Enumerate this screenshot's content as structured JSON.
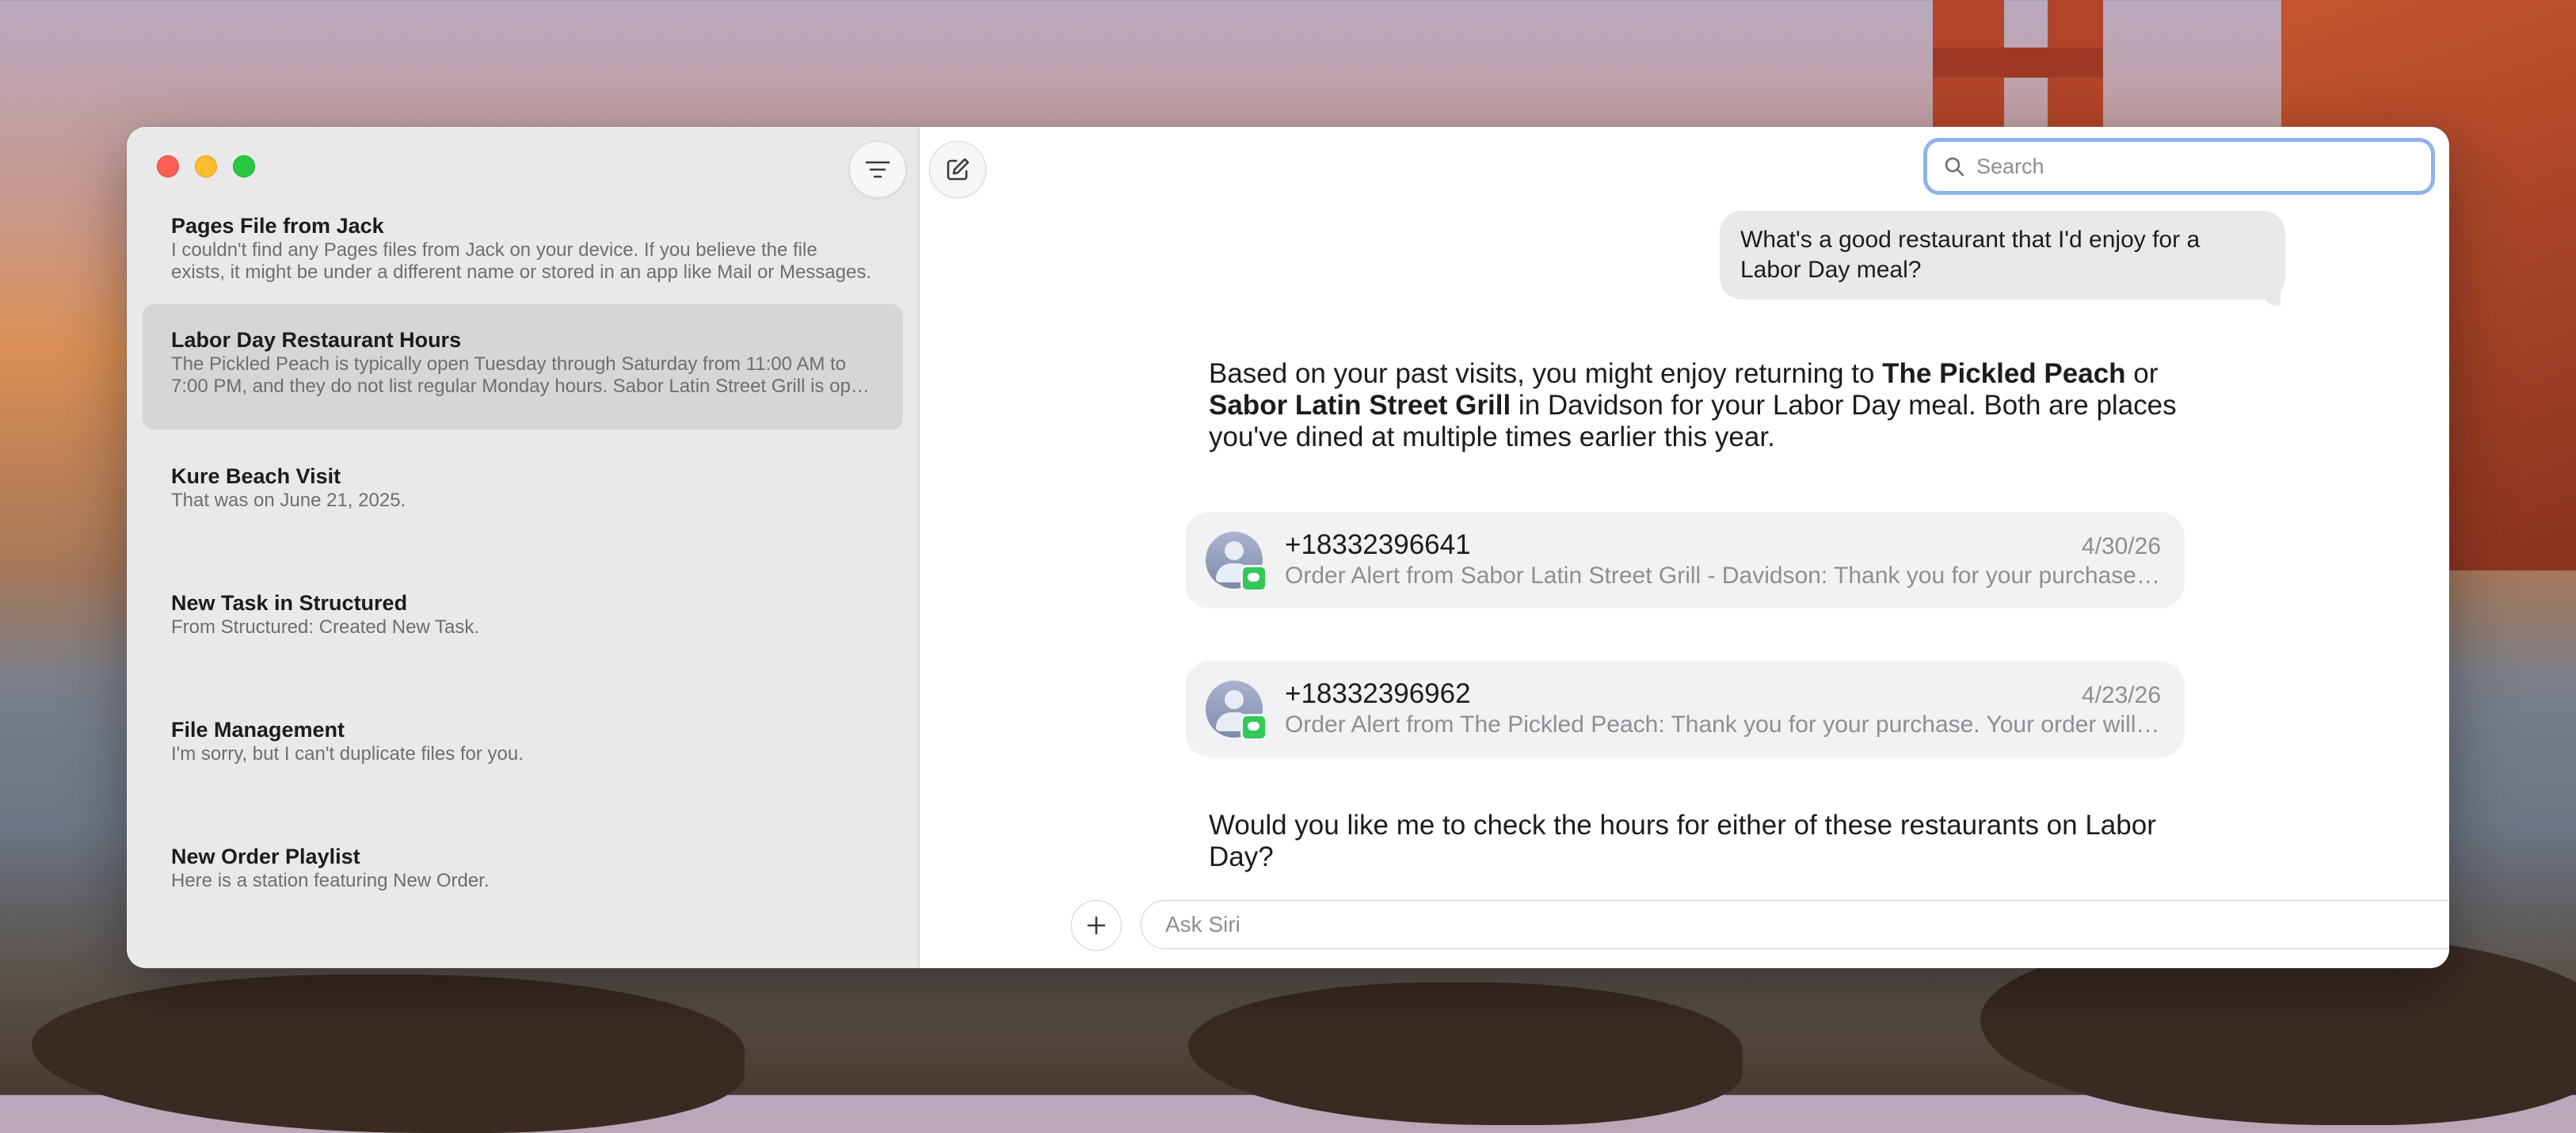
{
  "sidebar": {
    "conversations": [
      {
        "title": "Pages File from Jack",
        "preview": "I couldn't find any Pages files from Jack on your device. If you believe the file exists, it might be under a different name or stored in an app like Mail or Messages."
      },
      {
        "title": "Labor Day Restaurant Hours",
        "preview": "The Pickled Peach is typically open Tuesday through Saturday from 11:00 AM to 7:00 PM, and they do not list regular Monday hours. Sabor Latin Street Grill is open on Labor Day."
      },
      {
        "title": "Kure Beach Visit",
        "preview": "That was on June 21, 2025."
      },
      {
        "title": "New Task in Structured",
        "preview": "From Structured: Created New Task."
      },
      {
        "title": "File Management",
        "preview": "I'm sorry, but I can't duplicate files for you."
      },
      {
        "title": "New Order Playlist",
        "preview": "Here is a station featuring New Order."
      }
    ]
  },
  "search": {
    "placeholder": "Search"
  },
  "chat": {
    "user_message": "What's a good restaurant that I'd enjoy for a Labor Day meal?",
    "reply_1": {
      "t1": "Based on your past visits, you might enjoy returning to ",
      "b1": "The Pickled Peach",
      "t2": " or ",
      "b2": "Sabor Latin Street Grill",
      "t3": " in Davidson for your Labor Day meal. Both are places you've dined at multiple times earlier this year."
    },
    "messages": [
      {
        "sender": "+18332396641",
        "date": "4/30/26",
        "preview": "Order Alert from Sabor Latin Street Grill - Davidson: Thank you for your purchase. Your order will be ready soon."
      },
      {
        "sender": "+18332396962",
        "date": "4/23/26",
        "preview": "Order Alert from The Pickled Peach: Thank you for your purchase. Your order will be ready soon."
      }
    ],
    "reply_2": "Would you like me to check the hours for either of these restaurants on Labor Day?"
  },
  "composer": {
    "placeholder": "Ask Siri"
  },
  "colors": {
    "accent": "#8fb4ea",
    "selected_row": "#d6d6d8",
    "badge": "#34c759"
  }
}
